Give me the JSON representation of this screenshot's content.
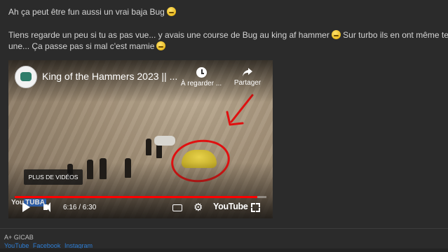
{
  "post": {
    "line1": "Ah ça peut être fun aussi un vrai baja Bug",
    "line2": "Tiens regarde un peu si tu as pas vue... y avais une course de Bug au king af hammer",
    "line2_end": "Sur turbo ils en ont même testé",
    "line3": "une... Ça passe pas si mal c'est mamie"
  },
  "video": {
    "title": "King of the Hammers 2023 || ...",
    "watch_later_label": "À regarder ...",
    "share_label": "Partager",
    "more_videos_label": "PLUS DE VIDÉOS",
    "time": "6:16 / 6:30",
    "progress": 0.965,
    "youtube_label": "YouTube",
    "watermark_you": "You",
    "watermark_tube": "TUBA"
  },
  "signature": {
    "text": "A+ GICAB",
    "links": [
      "YouTube",
      "Facebook",
      "Instagram"
    ]
  },
  "colors": {
    "background": "#2b2b2b",
    "text": "#d4d4d4",
    "link": "#2d7ed6",
    "annotation": "#e01010",
    "progress": "#ff0000"
  }
}
